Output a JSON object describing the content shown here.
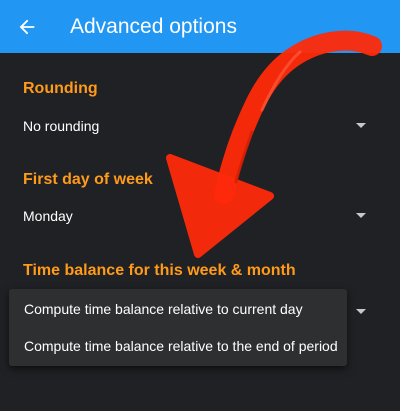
{
  "header": {
    "title": "Advanced options",
    "back_icon": "arrow-back-icon"
  },
  "colors": {
    "appbar": "#2196f3",
    "background": "#202124",
    "section_title": "#ff9a1a",
    "annotation_arrow": "#ff2a0a"
  },
  "sections": [
    {
      "title": "Rounding",
      "value": "No rounding"
    },
    {
      "title": "First day of week",
      "value": "Monday"
    },
    {
      "title": "Time balance for this week & month",
      "value": ""
    }
  ],
  "menu": {
    "options": [
      "Compute time balance relative to current day",
      "Compute time balance relative to the end of period"
    ]
  }
}
